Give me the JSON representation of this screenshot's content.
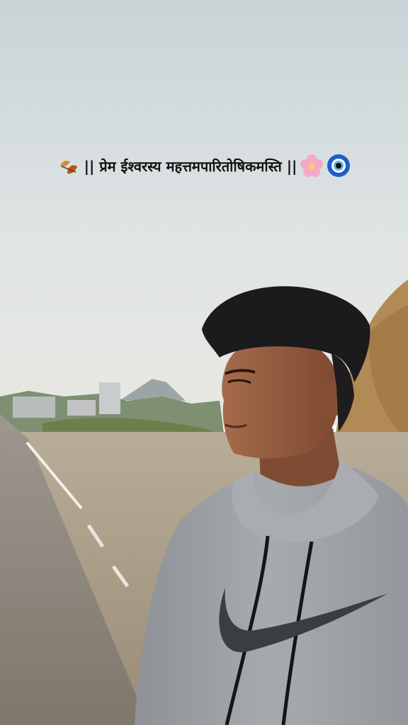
{
  "caption": {
    "text": "|| प्रेम ईश्वरस्य महत्तमपारितोषिकमस्ति ||",
    "left_emoji": "leaves-icon",
    "right_emojis": [
      "cherry-blossom-icon",
      "nazar-amulet-icon"
    ]
  },
  "colors": {
    "sky": "#d6dde0",
    "hoodie": "#9fa3a8",
    "hair": "#1b1a1d",
    "road": "#8c8276",
    "hill": "#b48a55"
  }
}
